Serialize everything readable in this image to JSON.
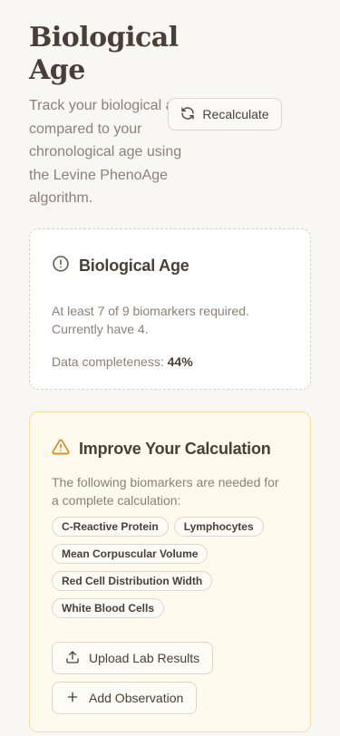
{
  "header": {
    "title": "Biological Age",
    "subtitle": "Track your biological age compared to your chronological age using the Levine PhenoAge algorithm.",
    "recalculate_label": "Recalculate"
  },
  "bio_card": {
    "title": "Biological Age",
    "requirement_text": "At least 7 of 9 biomarkers required. Currently have 4.",
    "completeness_label": "Data completeness:",
    "completeness_value": "44%"
  },
  "improve_card": {
    "title": "Improve Your Calculation",
    "description": "The following biomarkers are needed for a complete calculation:",
    "biomarkers": [
      "C-Reactive Protein",
      "Lymphocytes",
      "Mean Corpuscular Volume",
      "Red Cell Distribution Width",
      "White Blood Cells"
    ],
    "upload_label": "Upload Lab Results",
    "add_label": "Add Observation"
  },
  "icons": {
    "recalculate": "refresh-icon",
    "info": "alert-circle-icon",
    "warning": "warning-triangle-icon",
    "upload": "upload-icon",
    "add": "plus-icon"
  },
  "colors": {
    "background": "#f9f7f3",
    "heading": "#4a3f36",
    "muted": "#8c8077",
    "warning": "#d4891a",
    "improve_bg": "#fefaed",
    "improve_border": "#f1dfa2"
  }
}
